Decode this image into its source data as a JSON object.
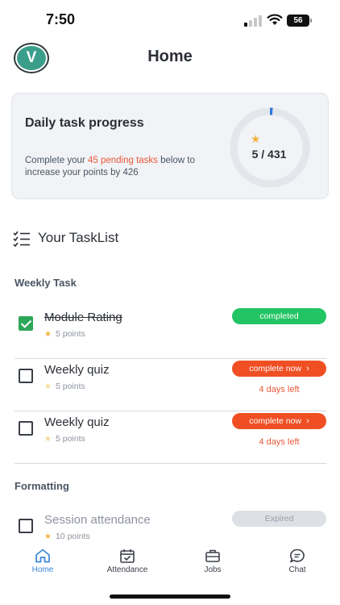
{
  "status_bar": {
    "time": "7:50",
    "battery": "56"
  },
  "header": {
    "avatar_letter": "V",
    "title": "Home",
    "avatar_color": "#3a9e8a"
  },
  "progress_card": {
    "title": "Daily task progress",
    "desc_prefix": "Complete your ",
    "desc_highlight": "45 pending tasks",
    "desc_suffix": " below to increase your points by 426",
    "progress_text": "5 / 431",
    "progress_fraction": 0.0116,
    "accent_color": "#e8583a"
  },
  "tasklist": {
    "title": "Your TaskList",
    "sections": [
      {
        "title": "Weekly Task",
        "tasks": [
          {
            "name": "Module Rating",
            "points": "5 points",
            "status": "completed",
            "checked": true,
            "due": ""
          },
          {
            "name": "Weekly quiz",
            "points": "5 points",
            "status": "complete now",
            "checked": false,
            "due": "4 days left"
          },
          {
            "name": "Weekly quiz",
            "points": "5 points",
            "status": "complete now",
            "checked": false,
            "due": "4 days left"
          }
        ]
      },
      {
        "title": "Formatting",
        "tasks": [
          {
            "name": "Session attendance",
            "points": "10 points",
            "status": "Expired",
            "checked": false,
            "due": ""
          }
        ]
      }
    ]
  },
  "bottom_nav": {
    "items": [
      {
        "label": "Home",
        "icon": "home-icon",
        "active": true
      },
      {
        "label": "Attendance",
        "icon": "calendar-check-icon",
        "active": false
      },
      {
        "label": "Jobs",
        "icon": "briefcase-icon",
        "active": false
      },
      {
        "label": "Chat",
        "icon": "chat-bubble-icon",
        "active": false
      }
    ]
  },
  "colors": {
    "completed": "#22c463",
    "complete_now": "#f04f24",
    "expired": "#dde0e4",
    "nav_active": "#3a86d9",
    "star": "#f2b33d"
  }
}
